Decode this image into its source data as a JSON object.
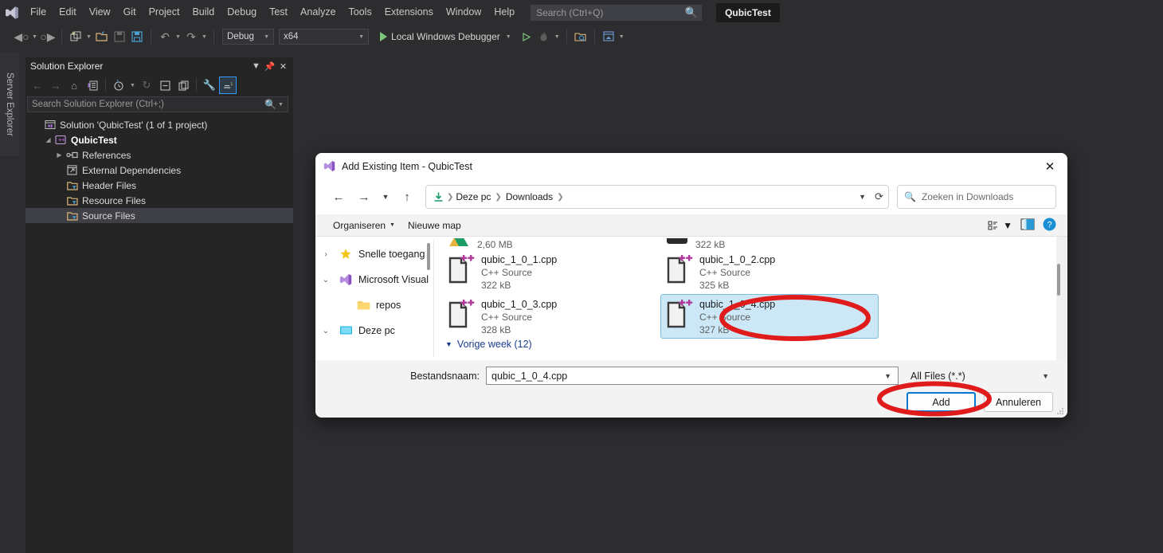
{
  "ide": {
    "menu_items": [
      "File",
      "Edit",
      "View",
      "Git",
      "Project",
      "Build",
      "Debug",
      "Test",
      "Analyze",
      "Tools",
      "Extensions",
      "Window",
      "Help"
    ],
    "search_placeholder": "Search (Ctrl+Q)",
    "project_badge": "QubicTest",
    "toolbar": {
      "config": "Debug",
      "platform": "x64",
      "debug_target": "Local Windows Debugger"
    },
    "server_explorer_tab": "Server Explorer",
    "solution_explorer": {
      "title": "Solution Explorer",
      "search_placeholder": "Search Solution Explorer (Ctrl+;)",
      "tree": [
        {
          "label": "Solution 'QubicTest' (1 of 1 project)",
          "indent": 0,
          "icon": "solution-icon",
          "expander": "",
          "bold": false,
          "selected": false
        },
        {
          "label": "QubicTest",
          "indent": 1,
          "icon": "cpp-project-icon",
          "expander": "▲",
          "bold": true,
          "selected": false
        },
        {
          "label": "References",
          "indent": 2,
          "icon": "references-icon",
          "expander": "▶",
          "bold": false,
          "selected": false
        },
        {
          "label": "External Dependencies",
          "indent": 2,
          "icon": "dependencies-icon",
          "expander": "",
          "bold": false,
          "selected": false
        },
        {
          "label": "Header Files",
          "indent": 2,
          "icon": "folder-filter-icon",
          "expander": "",
          "bold": false,
          "selected": false
        },
        {
          "label": "Resource Files",
          "indent": 2,
          "icon": "folder-filter-icon",
          "expander": "",
          "bold": false,
          "selected": false
        },
        {
          "label": "Source Files",
          "indent": 2,
          "icon": "folder-filter-icon",
          "expander": "",
          "bold": false,
          "selected": true
        }
      ]
    }
  },
  "dialog": {
    "title": "Add Existing Item - QubicTest",
    "close_label": "✕",
    "breadcrumbs": [
      "Deze pc",
      "Downloads"
    ],
    "search_placeholder": "Zoeken in Downloads",
    "commands": {
      "organize": "Organiseren",
      "new_folder": "Nieuwe map"
    },
    "nav_items": [
      {
        "label": "Snelle toegang",
        "chevron": "›",
        "icon": "star-icon",
        "indent": 0
      },
      {
        "label": "Microsoft Visual",
        "chevron": "⌄",
        "icon": "visual-studio-icon",
        "indent": 0
      },
      {
        "label": "repos",
        "chevron": "",
        "icon": "folder-icon",
        "indent": 1
      },
      {
        "label": "Deze pc",
        "chevron": "⌄",
        "icon": "this-pc-icon",
        "indent": 0
      }
    ],
    "cut_row": {
      "left_size": "2,60 MB",
      "right_size": "322 kB"
    },
    "files": [
      {
        "name": "qubic_1_0_1.cpp",
        "type": "C++ Source",
        "size": "322 kB",
        "selected": false
      },
      {
        "name": "qubic_1_0_2.cpp",
        "type": "C++ Source",
        "size": "325 kB",
        "selected": false
      },
      {
        "name": "qubic_1_0_3.cpp",
        "type": "C++ Source",
        "size": "328 kB",
        "selected": false
      },
      {
        "name": "qubic_1_0_4.cpp",
        "type": "C++ Source",
        "size": "327 kB",
        "selected": true
      }
    ],
    "group_next": "Vorige week (12)",
    "filename_label": "Bestandsnaam:",
    "filename_value": "qubic_1_0_4.cpp",
    "filter_value": "All Files (*.*)",
    "buttons": {
      "add": "Add",
      "cancel": "Annuleren"
    }
  },
  "annotations": {
    "color": "#e01b1b"
  }
}
